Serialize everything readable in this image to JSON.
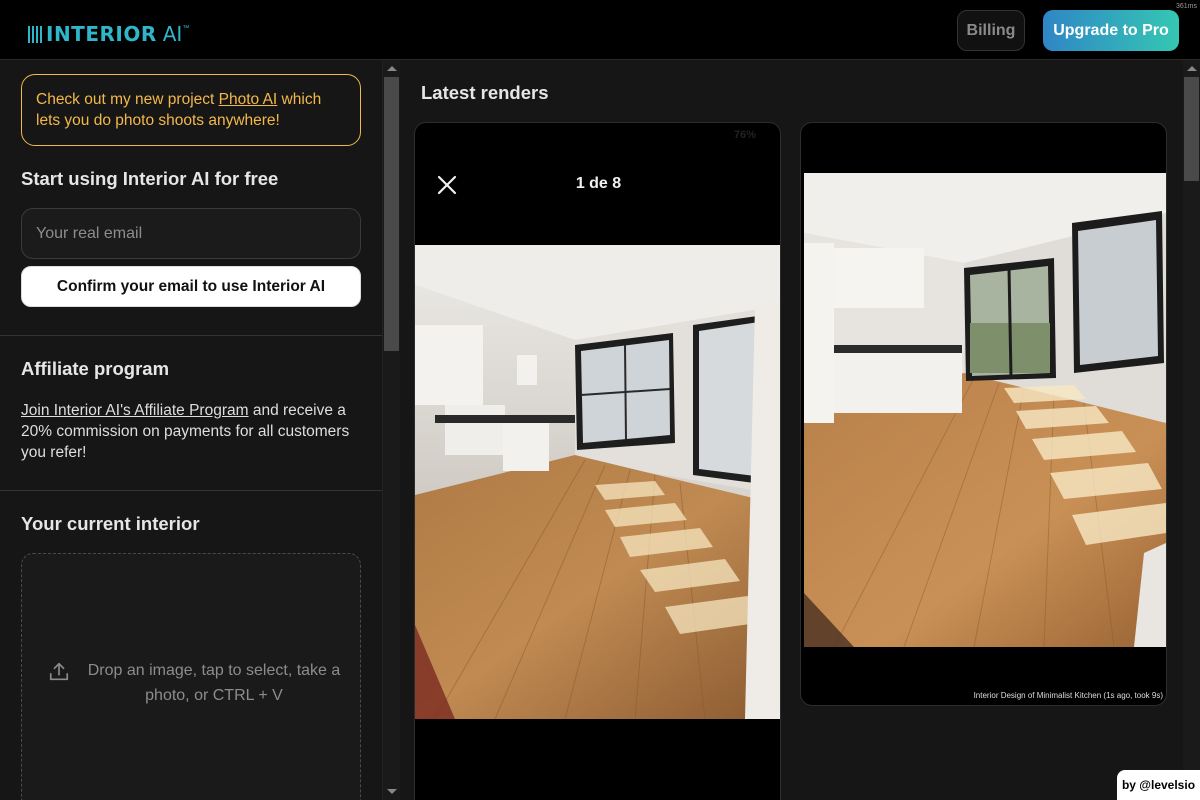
{
  "header": {
    "logo_text": "INTERIOR",
    "logo_ai": "AI",
    "logo_tm": "™",
    "timing": "361ms",
    "billing_label": "Billing",
    "upgrade_label": "Upgrade to Pro"
  },
  "sidebar": {
    "promo": {
      "before": "Check out my new project ",
      "link": "Photo AI",
      "after": " which lets you do photo shoots anywhere!"
    },
    "signup": {
      "title": "Start using Interior AI for free",
      "email_placeholder": "Your real email",
      "confirm_label": "Confirm your email to use Interior AI"
    },
    "affiliate": {
      "title": "Affiliate program",
      "link": "Join Interior AI's Affiliate Program",
      "text": " and receive a 20% commission on payments for all customers you refer!"
    },
    "current": {
      "title": "Your current interior",
      "drop_text": "Drop an image, tap to select, take a photo, or CTRL + V"
    }
  },
  "main": {
    "title": "Latest renders",
    "renders": [
      {
        "counter": "1 de 8",
        "status": "76%"
      },
      {
        "caption": "Interior Design of Minimalist Kitchen (1s ago, took 9s)"
      }
    ]
  },
  "footer": {
    "credit": "by @levelsio"
  },
  "colors": {
    "accent": "#2fb6c9",
    "promo": "#f3b84a",
    "upgrade_gradient_start": "#2f86c6",
    "upgrade_gradient_end": "#35c7b3"
  }
}
